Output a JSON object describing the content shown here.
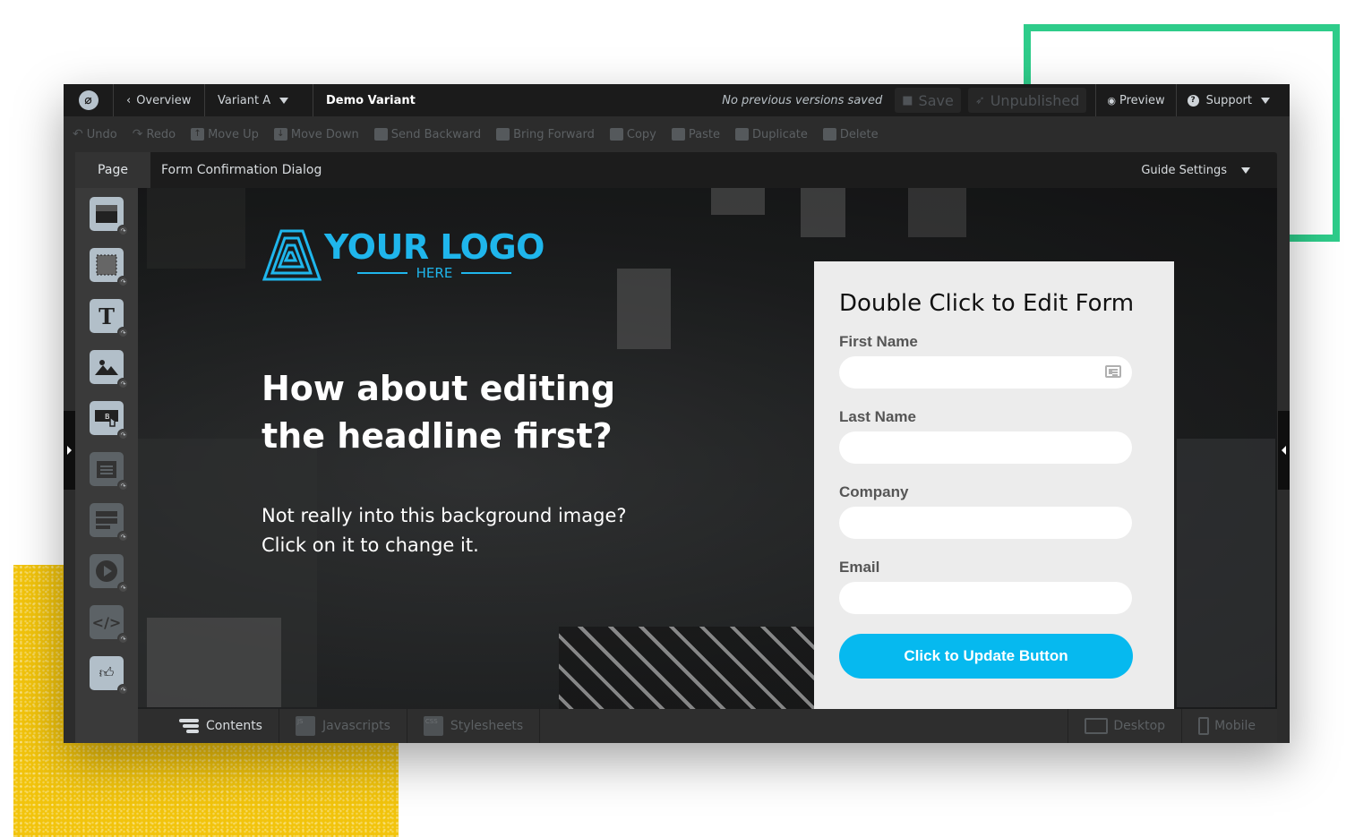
{
  "topbar": {
    "back_label": "Overview",
    "variant_label": "Variant A",
    "variant_title": "Demo Variant",
    "status": "No previous versions saved",
    "save_label": "Save",
    "publish_label": "Unpublished",
    "preview_label": "Preview",
    "support_label": "Support"
  },
  "toolbar": {
    "items": [
      {
        "label": "Undo",
        "icon": "undo-arrow"
      },
      {
        "label": "Redo",
        "icon": "redo-arrow"
      },
      {
        "label": "Move Up",
        "icon": "move-up"
      },
      {
        "label": "Move Down",
        "icon": "move-down"
      },
      {
        "label": "Send Backward",
        "icon": "send-backward"
      },
      {
        "label": "Bring Forward",
        "icon": "bring-forward"
      },
      {
        "label": "Copy",
        "icon": "copy"
      },
      {
        "label": "Paste",
        "icon": "paste"
      },
      {
        "label": "Duplicate",
        "icon": "duplicate"
      },
      {
        "label": "Delete",
        "icon": "trash"
      }
    ]
  },
  "pagebar": {
    "tab_label": "Page",
    "page_name": "Form Confirmation Dialog",
    "guide_label": "Guide Settings"
  },
  "sidebar": {
    "widgets": [
      {
        "name": "section",
        "state": "enabled"
      },
      {
        "name": "box",
        "state": "enabled"
      },
      {
        "name": "text",
        "state": "enabled"
      },
      {
        "name": "image",
        "state": "enabled"
      },
      {
        "name": "button",
        "state": "enabled"
      },
      {
        "name": "form",
        "state": "disabled"
      },
      {
        "name": "form-fields",
        "state": "disabled"
      },
      {
        "name": "video",
        "state": "disabled"
      },
      {
        "name": "custom-html",
        "state": "disabled"
      },
      {
        "name": "social",
        "state": "enabled"
      }
    ]
  },
  "canvas": {
    "logo_main": "YOUR LOGO",
    "logo_sub": "HERE",
    "headline": "How about editing the headline first?",
    "subtext": "Not really into this background image? Click on it to change it.",
    "form": {
      "title": "Double Click to Edit Form",
      "fields": [
        {
          "label": "First Name",
          "value": ""
        },
        {
          "label": "Last Name",
          "value": ""
        },
        {
          "label": "Company",
          "value": ""
        },
        {
          "label": "Email",
          "value": ""
        }
      ],
      "submit_label": "Click to Update Button"
    }
  },
  "bottombar": {
    "tabs": [
      {
        "label": "Contents",
        "active": true
      },
      {
        "label": "Javascripts",
        "active": false,
        "icon_text": "JS"
      },
      {
        "label": "Stylesheets",
        "active": false,
        "icon_text": "CSS"
      }
    ],
    "views": [
      {
        "label": "Desktop"
      },
      {
        "label": "Mobile"
      }
    ]
  },
  "colors": {
    "accent_blue": "#06b9ef",
    "logo_blue": "#1fb6ec",
    "deco_green": "#2ecc8a",
    "deco_yellow": "#f2c40c"
  }
}
